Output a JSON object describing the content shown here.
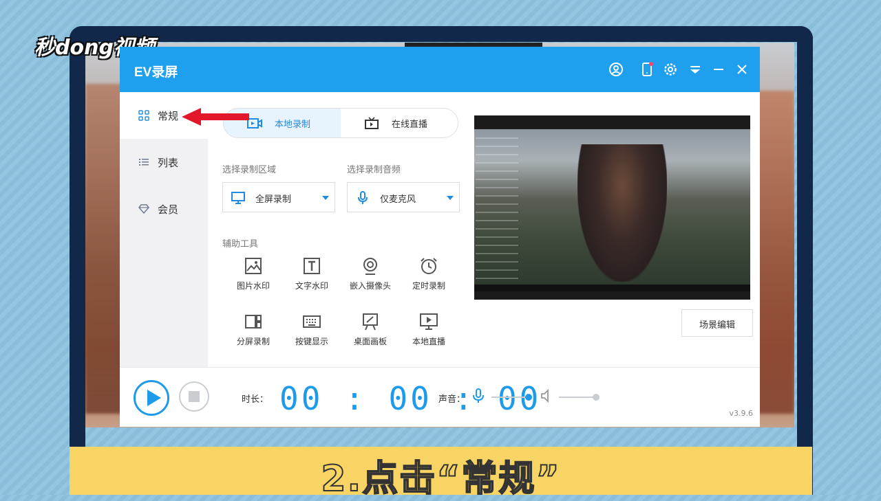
{
  "logo_text": "秒dong视频",
  "caption": "2.点击“常规”",
  "app": {
    "title": "EV录屏",
    "titlebar_icons": [
      "user-icon",
      "phone-icon",
      "gear-icon",
      "dropdown-icon",
      "minimize-icon",
      "close-icon"
    ]
  },
  "sidebar": {
    "items": [
      {
        "label": "常规",
        "icon": "grid-icon",
        "active": true
      },
      {
        "label": "列表",
        "icon": "list-icon",
        "active": false
      },
      {
        "label": "会员",
        "icon": "diamond-icon",
        "active": false
      }
    ]
  },
  "tabs": [
    {
      "label": "本地录制",
      "icon": "camera-icon",
      "active": true
    },
    {
      "label": "在线直播",
      "icon": "tv-icon",
      "active": false
    }
  ],
  "area": {
    "label": "选择录制区域",
    "value": "全屏录制"
  },
  "audio": {
    "label": "选择录制音频",
    "value": "仅麦克风"
  },
  "tools": {
    "label": "辅助工具",
    "items": [
      {
        "label": "图片水印",
        "icon": "image-icon"
      },
      {
        "label": "文字水印",
        "icon": "text-icon"
      },
      {
        "label": "嵌入摄像头",
        "icon": "webcam-icon"
      },
      {
        "label": "定时录制",
        "icon": "alarm-icon"
      },
      {
        "label": "分屏录制",
        "icon": "split-screen-icon"
      },
      {
        "label": "按键显示",
        "icon": "keyboard-icon"
      },
      {
        "label": "桌面画板",
        "icon": "easel-icon"
      },
      {
        "label": "本地直播",
        "icon": "monitor-play-icon"
      }
    ]
  },
  "scene_button": "场景编辑",
  "bottom": {
    "duration_label": "时长：",
    "timer": "00:00:00",
    "volume_label": "声音：",
    "mic_level": 1.0,
    "speaker_level": 1.0,
    "version": "v3.9.6"
  },
  "colors": {
    "accent": "#1ea0ee",
    "caption_bar": "#f7d463",
    "frame": "#11284a"
  }
}
